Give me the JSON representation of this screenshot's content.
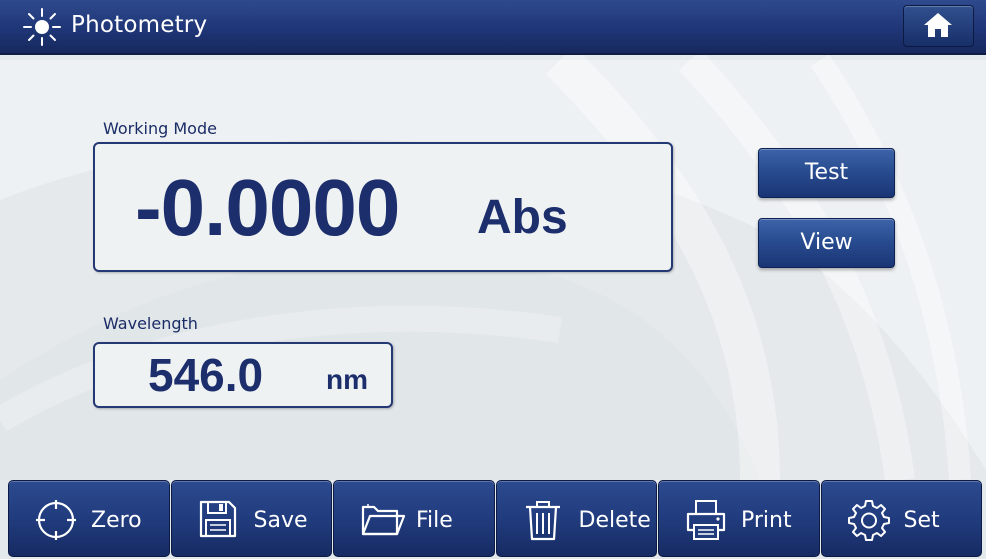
{
  "header": {
    "title": "Photometry",
    "title_icon": "sun-icon",
    "home_icon": "home-icon"
  },
  "measurement": {
    "mode_label": "Working Mode",
    "value": "-0.0000",
    "unit": "Abs"
  },
  "wavelength": {
    "label": "Wavelength",
    "value": "546.0",
    "unit": "nm"
  },
  "side_buttons": {
    "test": "Test",
    "view": "View"
  },
  "toolbar": {
    "items": [
      {
        "label": "Zero",
        "icon": "crosshair-icon"
      },
      {
        "label": "Save",
        "icon": "floppy-disk-icon"
      },
      {
        "label": "File",
        "icon": "folder-icon"
      },
      {
        "label": "Delete",
        "icon": "trash-icon"
      },
      {
        "label": "Print",
        "icon": "printer-icon"
      },
      {
        "label": "Set",
        "icon": "gear-icon"
      }
    ]
  },
  "colors": {
    "header_bg": "#1f3677",
    "accent": "#1c2e6b",
    "button_bg": "#274a8e",
    "panel_bg": "#eff2f3"
  }
}
